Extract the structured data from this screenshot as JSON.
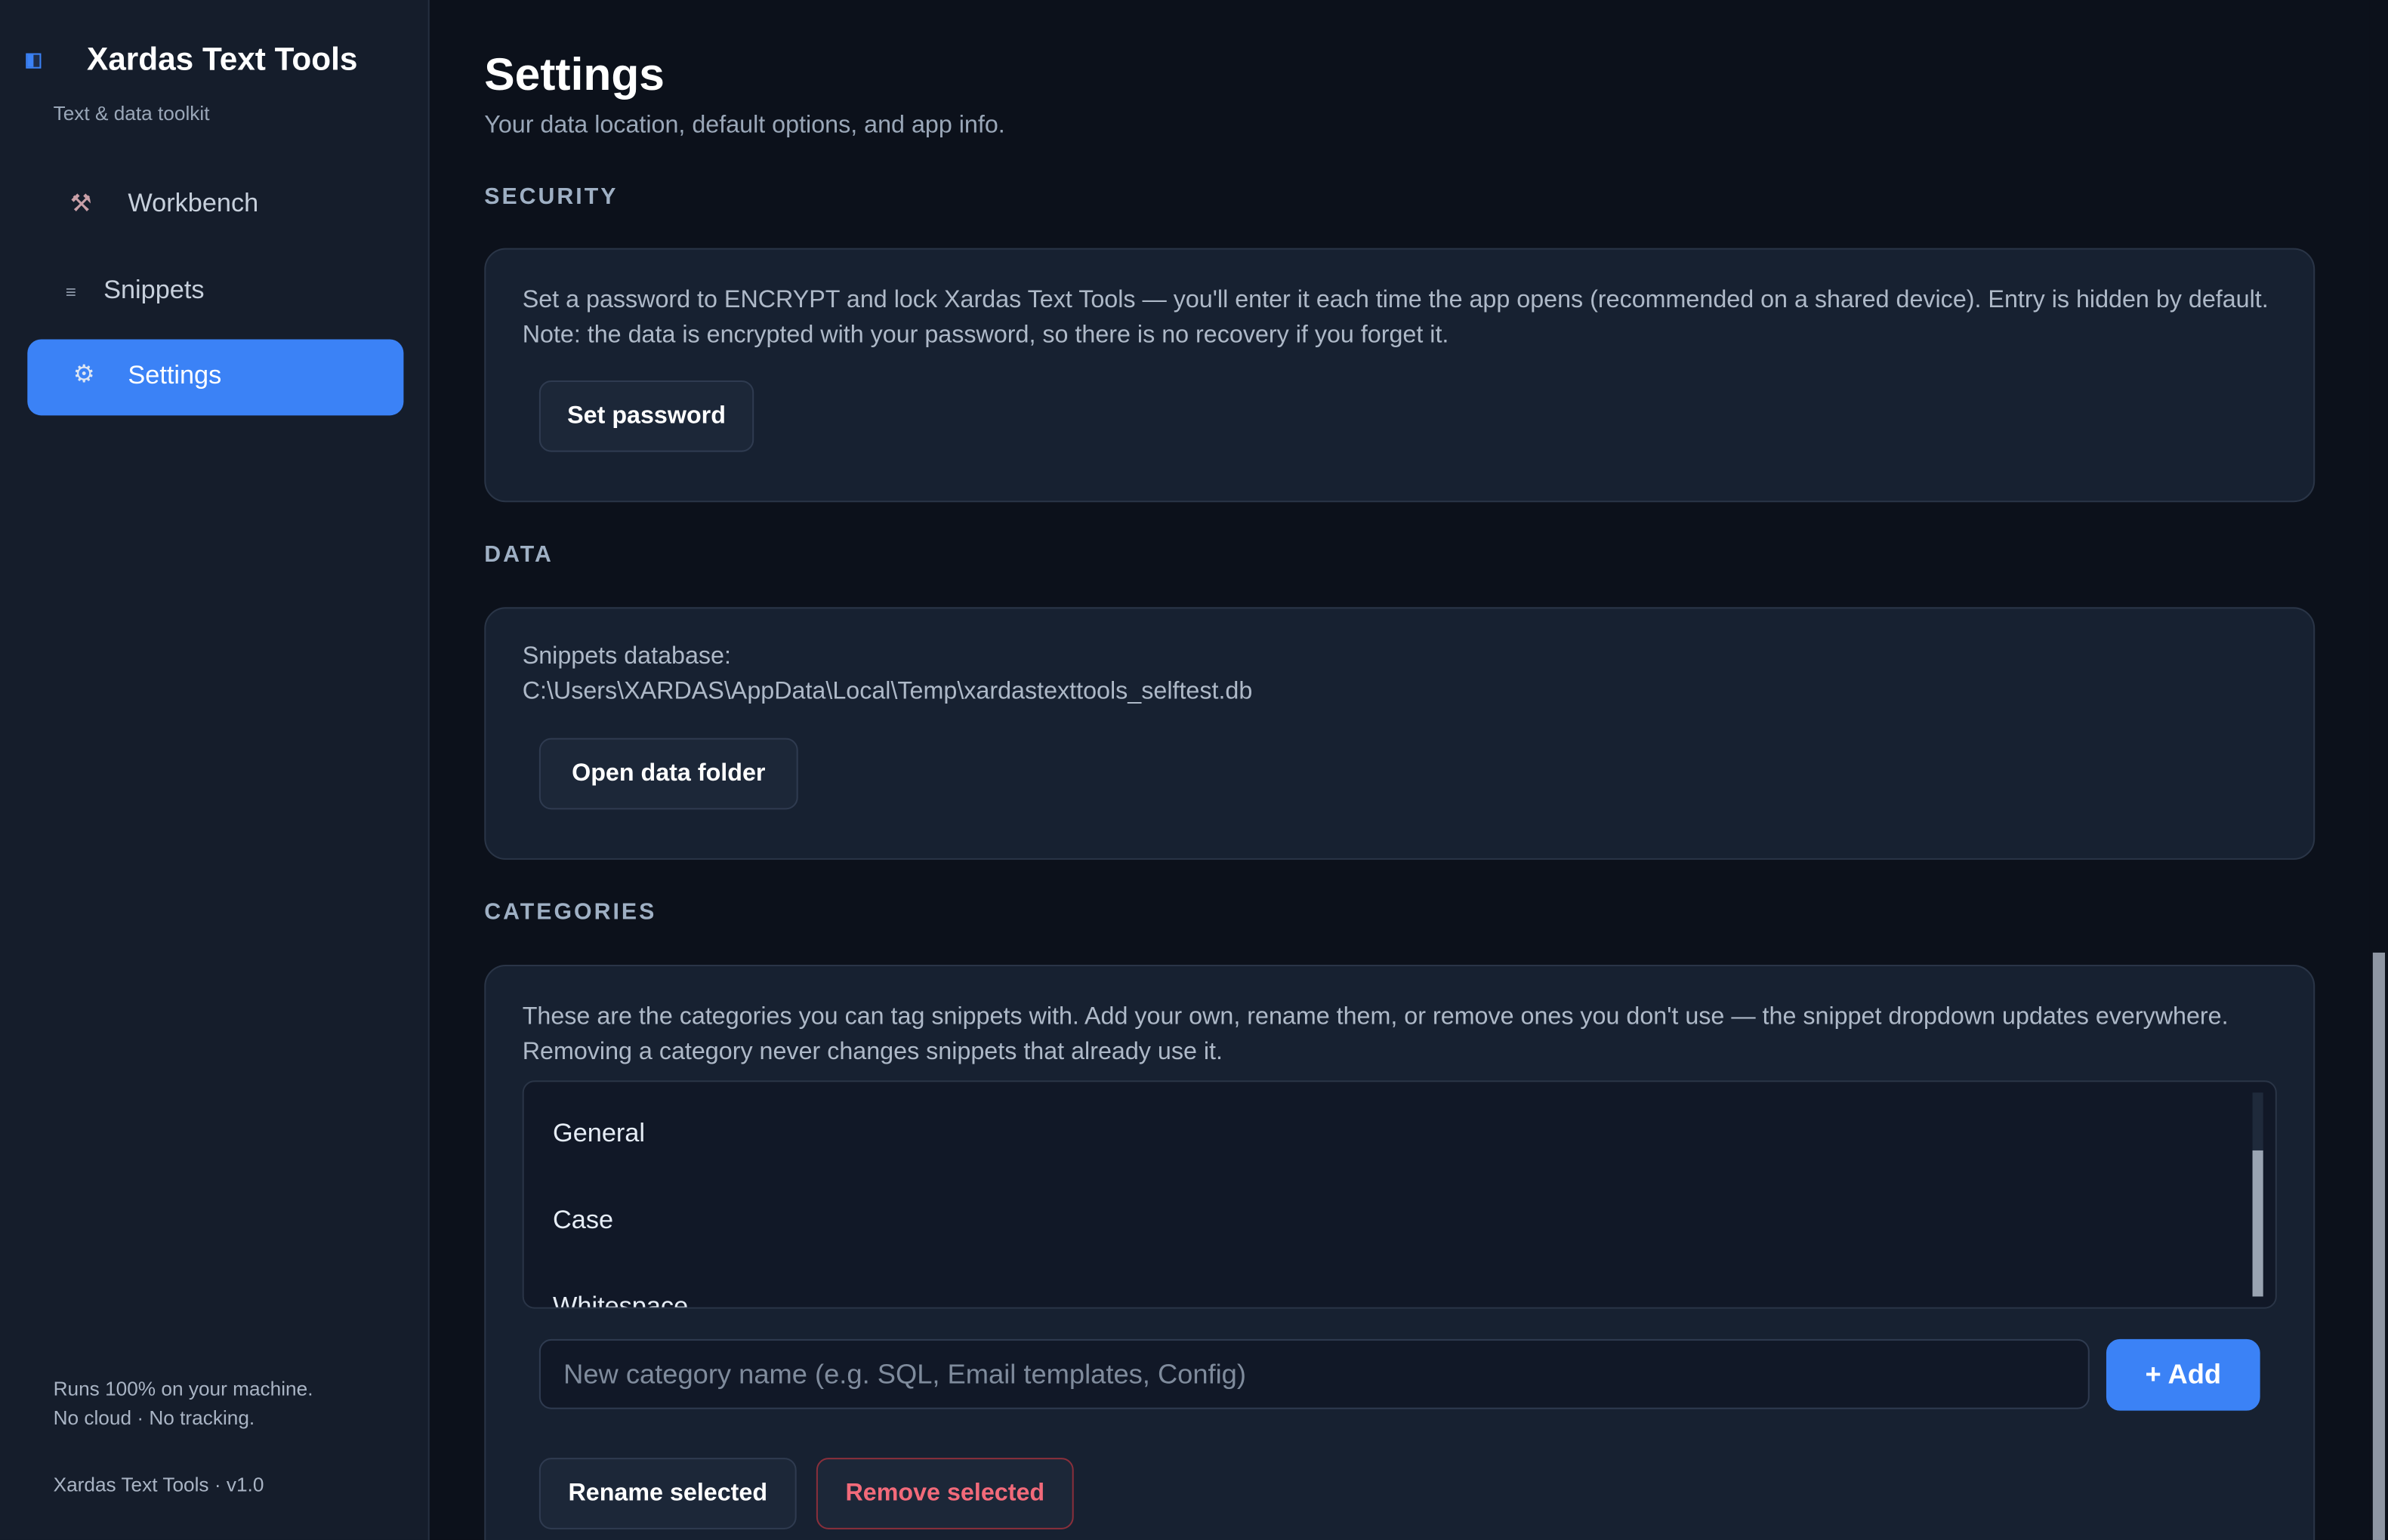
{
  "sidebar": {
    "app_title": "Xardas Text Tools",
    "app_subtitle": "Text & data toolkit",
    "nav": [
      {
        "label": "Workbench",
        "icon": "⚒"
      },
      {
        "label": "Snippets",
        "icon": "≡"
      },
      {
        "label": "Settings",
        "icon": "⚙"
      }
    ],
    "active_nav": "Settings",
    "footer_line1": "Runs 100% on your machine.",
    "footer_line2": "No cloud · No tracking.",
    "version": "Xardas Text Tools · v1.0"
  },
  "page": {
    "title": "Settings",
    "subtitle": "Your data location, default options, and app info."
  },
  "security": {
    "heading": "SECURITY",
    "description": "Set a password to ENCRYPT and lock Xardas Text Tools — you'll enter it each time the app opens (recommended on a shared device). Entry is hidden by default. Note: the data is encrypted with your password, so there is no recovery if you forget it.",
    "set_password_label": "Set password"
  },
  "data": {
    "heading": "DATA",
    "db_label": "Snippets database:",
    "db_path": "C:\\Users\\XARDAS\\AppData\\Local\\Temp\\xardastexttools_selftest.db",
    "open_folder_label": "Open data folder"
  },
  "categories": {
    "heading": "CATEGORIES",
    "description": "These are the categories you can tag snippets with. Add your own, rename them, or remove ones you don't use — the snippet dropdown updates everywhere. Removing a category never changes snippets that already use it.",
    "items": [
      "General",
      "Case",
      "Whitespace"
    ],
    "new_placeholder": "New category name (e.g. SQL, Email templates, Config)",
    "add_label": "+  Add",
    "rename_label": "Rename selected",
    "remove_label": "Remove selected"
  },
  "colors": {
    "accent": "#3b82f6",
    "danger": "#f26a7a",
    "background": "#0c111b",
    "sidebar": "#151d2b",
    "card": "#172131"
  }
}
